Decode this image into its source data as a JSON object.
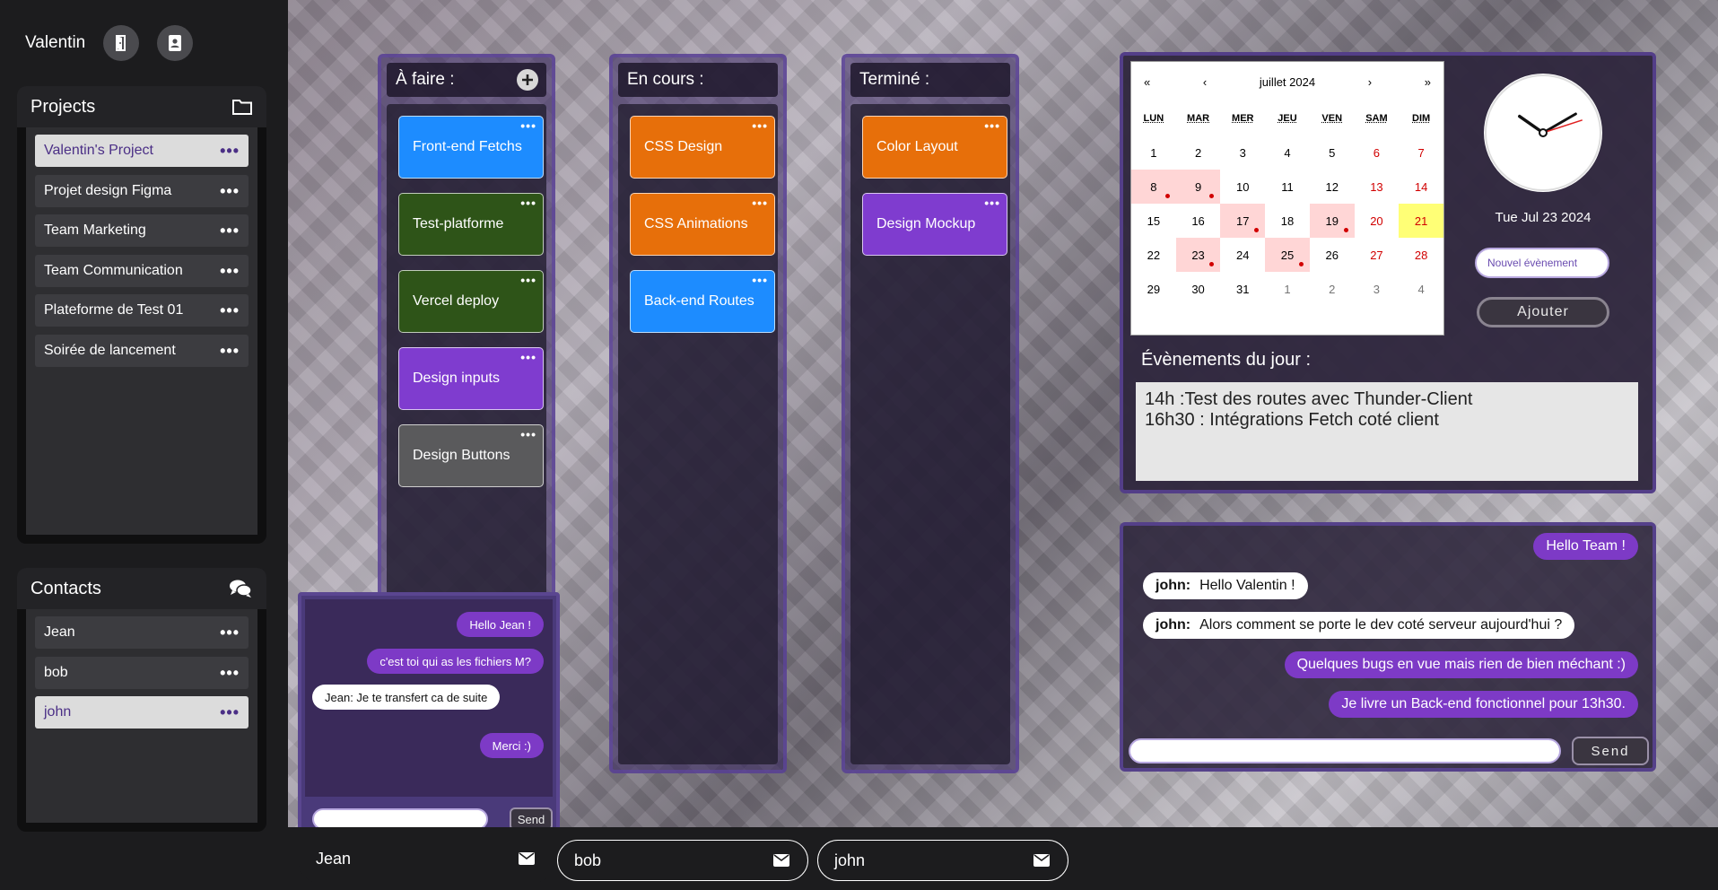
{
  "user": {
    "name": "Valentin"
  },
  "projects": {
    "title": "Projects",
    "items": [
      {
        "label": "Valentin's Project",
        "active": true
      },
      {
        "label": "Projet design Figma",
        "active": false
      },
      {
        "label": "Team Marketing",
        "active": false
      },
      {
        "label": "Team Communication",
        "active": false
      },
      {
        "label": "Plateforme de Test 01",
        "active": false
      },
      {
        "label": "Soirée de lancement",
        "active": false
      }
    ],
    "more": "•••"
  },
  "contacts": {
    "title": "Contacts",
    "items": [
      {
        "label": "Jean",
        "active": false
      },
      {
        "label": "bob",
        "active": false
      },
      {
        "label": "john",
        "active": true
      }
    ],
    "more": "•••"
  },
  "board": {
    "todo": {
      "title": "À faire :",
      "cards": [
        "Front-end Fetchs",
        "Test-platforme",
        "Vercel deploy",
        "Design inputs",
        "Design Buttons"
      ]
    },
    "doing": {
      "title": "En cours :",
      "cards": [
        "CSS Design",
        "CSS Animations",
        "Back-end Routes"
      ]
    },
    "done": {
      "title": "Terminé :",
      "cards": [
        "Color Layout",
        "Design Mockup"
      ]
    },
    "card_more": "•••"
  },
  "calendar": {
    "nav": {
      "prev_year": "«",
      "prev_month": "‹",
      "month_label": "juillet 2024",
      "next_month": "›",
      "next_year": "»"
    },
    "weekdays": [
      "LUN",
      "MAR",
      "MER",
      "JEU",
      "VEN",
      "SAM",
      "DIM"
    ],
    "weeks": [
      [
        "1",
        "2",
        "3",
        "4",
        "5",
        "6",
        "7"
      ],
      [
        "8",
        "9",
        "10",
        "11",
        "12",
        "13",
        "14"
      ],
      [
        "15",
        "16",
        "17",
        "18",
        "19",
        "20",
        "21"
      ],
      [
        "22",
        "23",
        "24",
        "25",
        "26",
        "27",
        "28"
      ],
      [
        "29",
        "30",
        "31",
        "1",
        "2",
        "3",
        "4"
      ]
    ],
    "event_days": [
      "8",
      "9",
      "17",
      "19",
      "23",
      "25"
    ],
    "today": "21",
    "highlight_color": "#ffff76"
  },
  "clock": {
    "date_text": "Tue Jul 23 2024",
    "hours": 10,
    "minutes": 10,
    "seconds": 12
  },
  "event_form": {
    "placeholder": "Nouvel évènement",
    "button": "Ajouter"
  },
  "day_events": {
    "title": "Évènements du jour :",
    "lines": [
      "14h :Test des routes avec Thunder-Client",
      "16h30 : Intégrations Fetch coté client"
    ]
  },
  "team_chat": {
    "messages": [
      {
        "own": true,
        "sender": "",
        "text": "Hello Team !"
      },
      {
        "own": false,
        "sender": "john:",
        "text": "Hello Valentin !"
      },
      {
        "own": false,
        "sender": "john:",
        "text": "Alors comment se porte le dev coté serveur aujourd'hui ?"
      },
      {
        "own": true,
        "sender": "",
        "text": "Quelques bugs en vue mais rien de bien méchant :)"
      },
      {
        "own": true,
        "sender": "",
        "text": "Je livre un Back-end fonctionnel pour 13h30."
      }
    ],
    "send": "Send"
  },
  "dm_chat": {
    "messages": [
      {
        "own": true,
        "text": "Hello Jean !"
      },
      {
        "own": true,
        "text": "c'est toi qui as les fichiers M?"
      },
      {
        "own": false,
        "text": "Jean:  Je te transfert ca de suite"
      },
      {
        "own": true,
        "text": "Merci :)"
      }
    ],
    "send": "Send"
  },
  "chat_tabs": [
    {
      "label": "Jean",
      "active": true
    },
    {
      "label": "bob",
      "active": false
    },
    {
      "label": "john",
      "active": false
    }
  ],
  "colors": {
    "accent": "#7d3ac6",
    "brand_purple": "#4b2f86"
  }
}
